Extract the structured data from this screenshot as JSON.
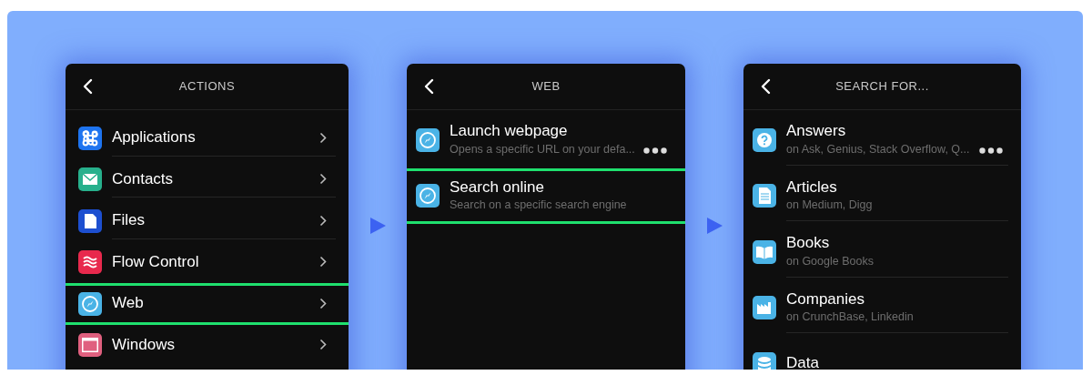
{
  "screens": [
    {
      "title": "ACTIONS",
      "items": [
        {
          "label": "Applications",
          "kind": "command",
          "color": "#1e74f0",
          "selected": false,
          "chevron": true
        },
        {
          "label": "Contacts",
          "kind": "mail",
          "color": "#27b08c",
          "selected": false,
          "chevron": true
        },
        {
          "label": "Files",
          "kind": "file",
          "color": "#1d4fd0",
          "selected": false,
          "chevron": true
        },
        {
          "label": "Flow Control",
          "kind": "waves",
          "color": "#e8294d",
          "selected": false,
          "chevron": true
        },
        {
          "label": "Web",
          "kind": "compass",
          "color": "#4ab3e6",
          "selected": true,
          "chevron": true
        },
        {
          "label": "Windows",
          "kind": "window",
          "color": "#e0607f",
          "selected": false,
          "chevron": true
        }
      ]
    },
    {
      "title": "WEB",
      "items": [
        {
          "label": "Launch webpage",
          "subtitle": "Opens a specific URL on your defa...",
          "kind": "compass",
          "color": "#4ab3e6",
          "selected": false,
          "more": true
        },
        {
          "label": "Search online",
          "subtitle": "Search on a specific search engine",
          "kind": "compass",
          "color": "#4ab3e6",
          "selected": true,
          "more": false
        }
      ]
    },
    {
      "title": "SEARCH FOR...",
      "items": [
        {
          "label": "Answers",
          "subtitle": "on Ask, Genius, Stack Overflow, Q...",
          "kind": "question",
          "color": "#4ab3e6",
          "selected": false,
          "more": true
        },
        {
          "label": "Articles",
          "subtitle": "on Medium, Digg",
          "kind": "doc",
          "color": "#4ab3e6",
          "selected": false,
          "more": false
        },
        {
          "label": "Books",
          "subtitle": "on Google Books",
          "kind": "book",
          "color": "#4ab3e6",
          "selected": false,
          "more": false
        },
        {
          "label": "Companies",
          "subtitle": "on CrunchBase, Linkedin",
          "kind": "factory",
          "color": "#4ab3e6",
          "selected": false,
          "more": false
        },
        {
          "label": "Data",
          "kind": "database",
          "color": "#4ab3e6",
          "selected": false,
          "more": false
        }
      ]
    }
  ]
}
